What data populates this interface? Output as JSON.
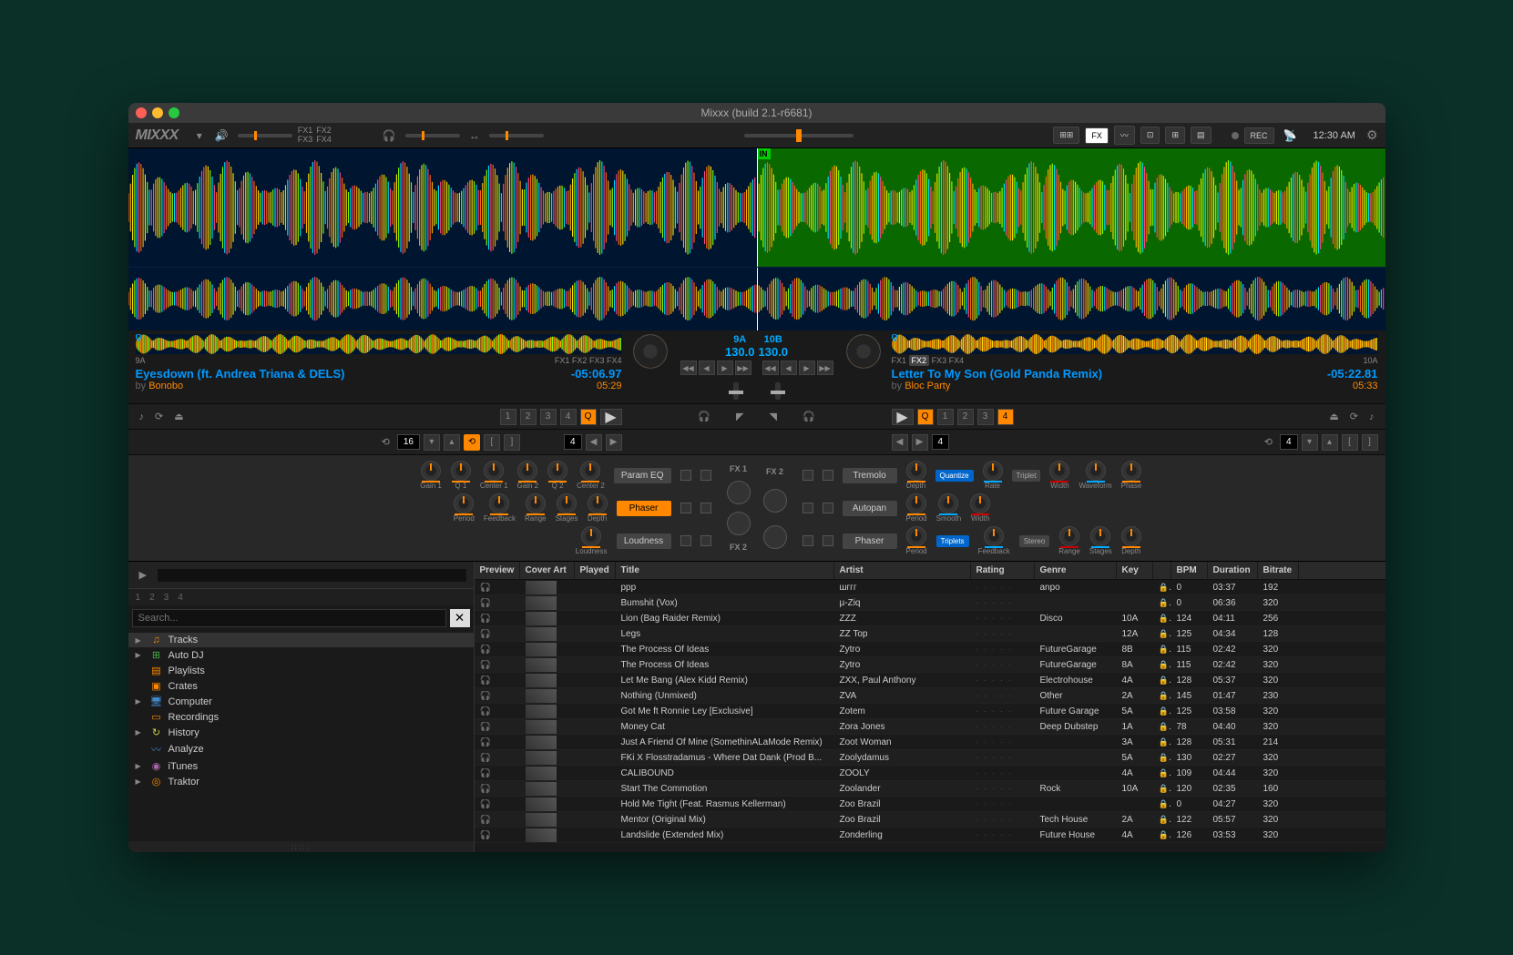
{
  "window": {
    "title": "Mixxx (build 2.1-r6681)"
  },
  "toolbar": {
    "logo": "MIXXX",
    "fx_labels": [
      "FX1",
      "FX2",
      "FX3",
      "FX4"
    ],
    "buttons": {
      "sampler": "⊞⊞",
      "fx": "FX",
      "rec": "REC"
    },
    "clock": "12:30 AM"
  },
  "deck1": {
    "title": "Eyesdown (ft. Andrea Triana & DELS)",
    "by": "by",
    "artist": "Bonobo",
    "remaining": "-05:06.97",
    "duration": "05:29",
    "key": "9A",
    "key_label": "9A",
    "bpm": "130.0",
    "fx": [
      "FX1",
      "FX2",
      "FX3",
      "FX4"
    ],
    "cues": [
      "1",
      "2",
      "3",
      "4"
    ],
    "q": "Q",
    "loop": "16",
    "beatjump": "4"
  },
  "deck2": {
    "title": "Letter To My Son (Gold Panda Remix)",
    "by": "by",
    "artist": "Bloc Party",
    "remaining": "-05:22.81",
    "duration": "05:33",
    "key": "10B",
    "key_label": "10A",
    "bpm": "130.0",
    "fx": [
      "FX1",
      "FX2",
      "FX3",
      "FX4"
    ],
    "fx_active": "FX2",
    "cues": [
      "1",
      "2",
      "3",
      "4"
    ],
    "cue_active": "4",
    "q": "Q",
    "loop": "4",
    "beatjump": "4"
  },
  "fx1": {
    "label": "FX 1",
    "unit1": {
      "name": "Param EQ",
      "knobs": [
        "Gain 1",
        "Q 1",
        "Center 1",
        "Gain 2",
        "Q 2",
        "Center 2"
      ]
    },
    "unit2": {
      "name": "Phaser",
      "knobs": [
        "Period",
        "Feedback",
        "Range",
        "Stages",
        "Depth"
      ]
    },
    "unit3": {
      "name": "Loudness",
      "knobs": [
        "Loudness"
      ]
    }
  },
  "fx2": {
    "label": "FX 2",
    "unit1": {
      "name": "Tremolo",
      "knobs": [
        "Depth",
        "Rate",
        "Width",
        "Waveform",
        "Phase"
      ],
      "btns": [
        "Quantize",
        "Triplet"
      ]
    },
    "unit2": {
      "name": "Autopan",
      "knobs": [
        "Period",
        "Smooth",
        "Width"
      ]
    },
    "unit3": {
      "name": "Phaser",
      "knobs": [
        "Period",
        "Feedback",
        "Range",
        "Stages",
        "Depth"
      ],
      "btns": [
        "Triplets",
        "Stereo"
      ]
    }
  },
  "library": {
    "search_placeholder": "Search...",
    "preview_decks": [
      "1",
      "2",
      "3",
      "4"
    ],
    "tree": [
      {
        "label": "Tracks",
        "icon": "♫",
        "color": "ti-orange",
        "arrow": "▶",
        "selected": true
      },
      {
        "label": "Auto DJ",
        "icon": "⊞",
        "color": "ti-green",
        "arrow": "▶"
      },
      {
        "label": "Playlists",
        "icon": "▤",
        "color": "ti-orange",
        "arrow": ""
      },
      {
        "label": "Crates",
        "icon": "▣",
        "color": "ti-orange",
        "arrow": ""
      },
      {
        "label": "Computer",
        "icon": "🖥",
        "color": "ti-blue",
        "arrow": "▶"
      },
      {
        "label": "Recordings",
        "icon": "▭",
        "color": "ti-orange",
        "arrow": ""
      },
      {
        "label": "History",
        "icon": "↻",
        "color": "ti-yellow",
        "arrow": "▶"
      },
      {
        "label": "Analyze",
        "icon": "〰",
        "color": "ti-blue",
        "arrow": ""
      },
      {
        "label": "iTunes",
        "icon": "◉",
        "color": "ti-purple",
        "arrow": "▶"
      },
      {
        "label": "Traktor",
        "icon": "◎",
        "color": "ti-orange",
        "arrow": "▶"
      }
    ],
    "columns": [
      "Preview",
      "Cover Art",
      "Played",
      "Title",
      "Artist",
      "Rating",
      "Genre",
      "Key",
      "",
      "BPM",
      "Duration",
      "Bitrate"
    ],
    "rows": [
      {
        "title": "ppp",
        "artist": "шггг",
        "genre": "anpo",
        "key": "",
        "bpm": "0",
        "dur": "03:37",
        "bit": "192"
      },
      {
        "title": "Bumshit (Vox)",
        "artist": "µ-Ziq",
        "genre": "",
        "key": "",
        "bpm": "0",
        "dur": "06:36",
        "bit": "320"
      },
      {
        "title": "Lion (Bag Raider Remix)",
        "artist": "ZZZ",
        "genre": "Disco",
        "key": "10A",
        "bpm": "124",
        "dur": "04:11",
        "bit": "256"
      },
      {
        "title": "Legs",
        "artist": "ZZ Top",
        "genre": "",
        "key": "12A",
        "bpm": "125",
        "dur": "04:34",
        "bit": "128"
      },
      {
        "title": "The Process Of Ideas",
        "artist": "Zytro",
        "genre": "FutureGarage",
        "key": "8B",
        "bpm": "115",
        "dur": "02:42",
        "bit": "320"
      },
      {
        "title": "The Process Of Ideas",
        "artist": "Zytro",
        "genre": "FutureGarage",
        "key": "8A",
        "bpm": "115",
        "dur": "02:42",
        "bit": "320"
      },
      {
        "title": "Let Me Bang (Alex Kidd Remix)",
        "artist": "ZXX, Paul Anthony",
        "genre": "Electrohouse",
        "key": "4A",
        "bpm": "128",
        "dur": "05:37",
        "bit": "320"
      },
      {
        "title": "Nothing (Unmixed)",
        "artist": "ZVA",
        "genre": "Other",
        "key": "2A",
        "bpm": "145",
        "dur": "01:47",
        "bit": "230"
      },
      {
        "title": "Got Me ft Ronnie Ley [Exclusive]",
        "artist": "Zotem",
        "genre": "Future Garage",
        "key": "5A",
        "bpm": "125",
        "dur": "03:58",
        "bit": "320"
      },
      {
        "title": "Money Cat",
        "artist": "Zora Jones",
        "genre": "Deep Dubstep",
        "key": "1A",
        "bpm": "78",
        "dur": "04:40",
        "bit": "320"
      },
      {
        "title": "Just A Friend Of Mine (SomethinALaMode Remix)",
        "artist": "Zoot Woman",
        "genre": "",
        "key": "3A",
        "bpm": "128",
        "dur": "05:31",
        "bit": "214"
      },
      {
        "title": "FKi X Flosstradamus - Where Dat Dank (Prod B...",
        "artist": "Zoolydamus",
        "genre": "",
        "key": "5A",
        "bpm": "130",
        "dur": "02:27",
        "bit": "320"
      },
      {
        "title": "CALIBOUND",
        "artist": "ZOOLY",
        "genre": "",
        "key": "4A",
        "bpm": "109",
        "dur": "04:44",
        "bit": "320"
      },
      {
        "title": "Start The Commotion",
        "artist": "Zoolander",
        "genre": "Rock",
        "key": "10A",
        "bpm": "120",
        "dur": "02:35",
        "bit": "160"
      },
      {
        "title": "Hold Me Tight (Feat. Rasmus Kellerman)",
        "artist": "Zoo Brazil",
        "genre": "",
        "key": "",
        "bpm": "0",
        "dur": "04:27",
        "bit": "320"
      },
      {
        "title": "Mentor (Original Mix)",
        "artist": "Zoo Brazil",
        "genre": "Tech House",
        "key": "2A",
        "bpm": "122",
        "dur": "05:57",
        "bit": "320"
      },
      {
        "title": "Landslide (Extended Mix)",
        "artist": "Zonderling",
        "genre": "Future House",
        "key": "4A",
        "bpm": "126",
        "dur": "03:53",
        "bit": "320"
      }
    ]
  }
}
